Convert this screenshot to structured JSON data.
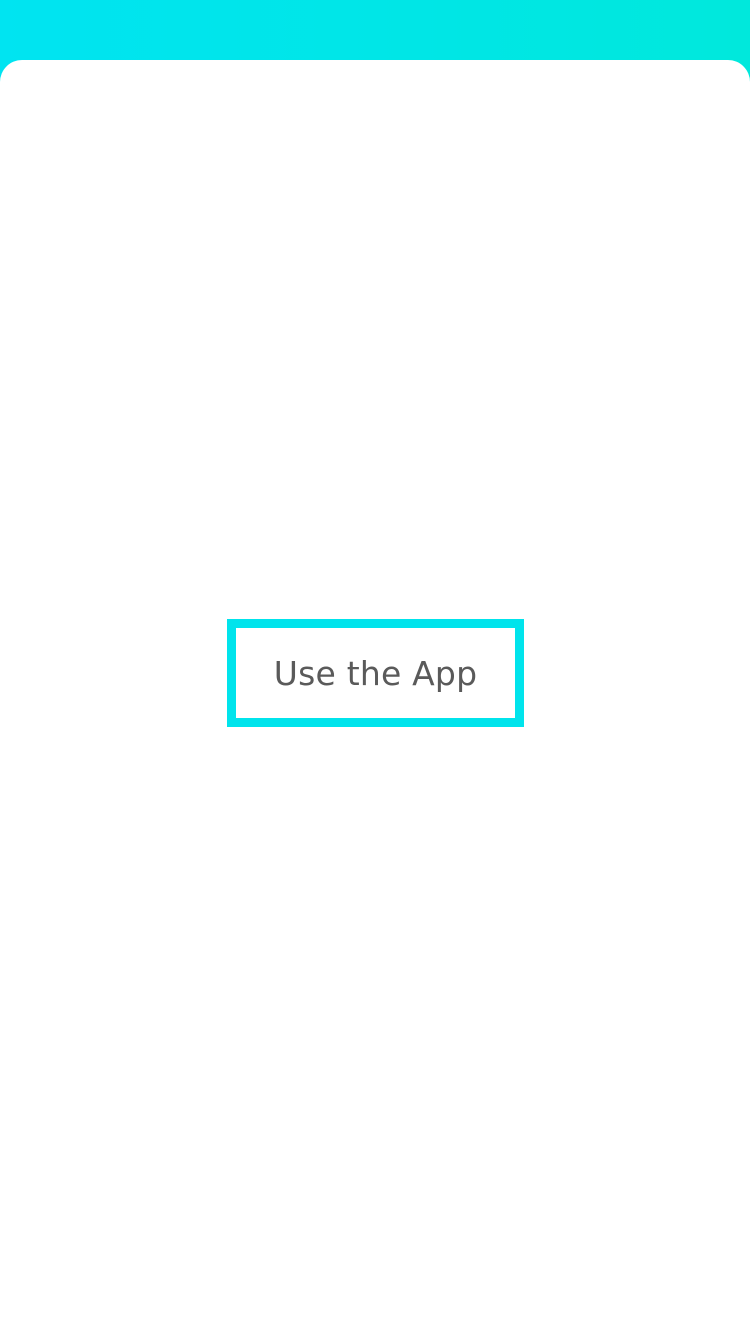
{
  "colors": {
    "top_gradient_start": "#00e4f1",
    "top_gradient_end": "#00e8dc",
    "button_border": "#00e4ec",
    "button_text": "#5a5a5a",
    "background": "#ffffff"
  },
  "main": {
    "use_app_label": "Use the App"
  }
}
